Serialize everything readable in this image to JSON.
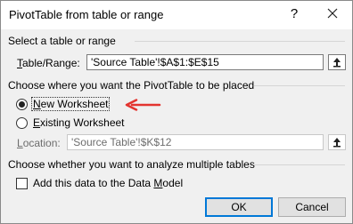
{
  "dialog": {
    "title": "PivotTable from table or range",
    "help": "?",
    "close_icon": "close-icon"
  },
  "select_section": {
    "heading": "Select a table or range",
    "table_range_label_first": "T",
    "table_range_label_rest": "able/Range:",
    "table_range_value": "'Source Table'!$A$1:$E$15",
    "collapse_icon": "collapse-dialog-icon"
  },
  "placement_section": {
    "heading": "Choose where you want the PivotTable to be placed",
    "new_worksheet_first": "N",
    "new_worksheet_rest": "ew Worksheet",
    "new_worksheet_selected": true,
    "existing_worksheet_first": "E",
    "existing_worksheet_rest": "xisting Worksheet",
    "location_label_first": "L",
    "location_label_rest": "ocation:",
    "location_value": "'Source Table'!$K$12",
    "annotation_color": "#e3342f"
  },
  "analyze_section": {
    "heading": "Choose whether you want to analyze multiple tables",
    "data_model_first": "M",
    "data_model_prefix": "Add this data to the Data ",
    "data_model_rest": "odel",
    "data_model_checked": false
  },
  "buttons": {
    "ok": "OK",
    "cancel": "Cancel"
  },
  "colors": {
    "default_button_border": "#0078d7",
    "dialog_background": "#f0f0f0"
  }
}
